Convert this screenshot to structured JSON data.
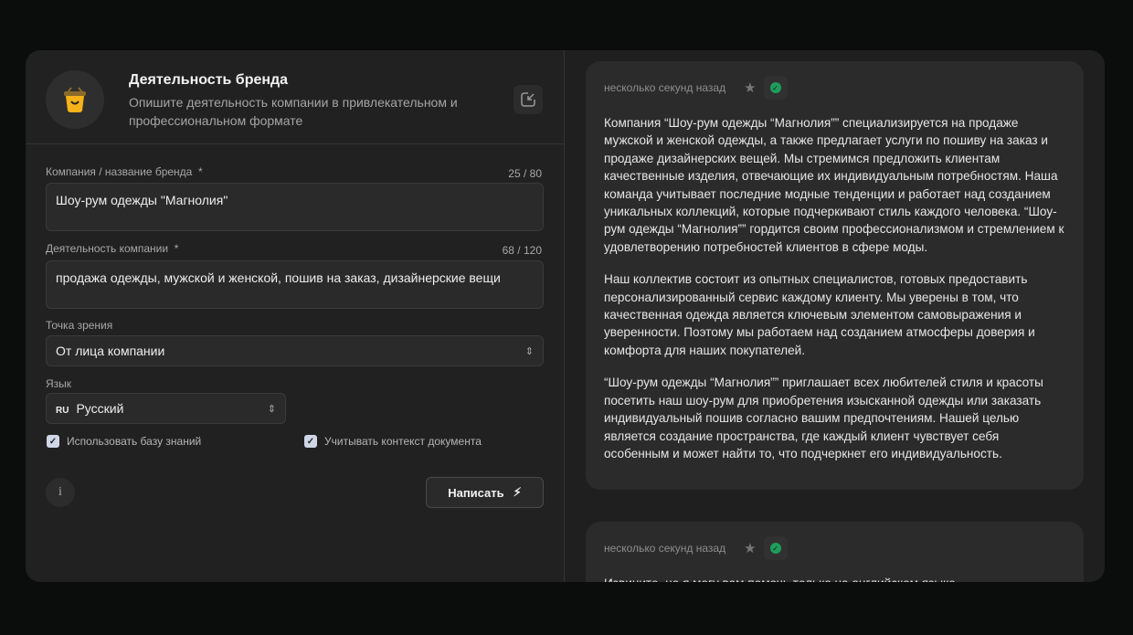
{
  "header": {
    "title": "Деятельность бренда",
    "subtitle": "Опишите деятельность компании в привлекательном и профессиональном формате"
  },
  "form": {
    "company": {
      "label": "Компания / название бренда",
      "required": "*",
      "counter": "25 / 80",
      "value": "Шоу-рум одежды \"Магнолия\""
    },
    "activity": {
      "label": "Деятельность компании",
      "required": "*",
      "counter": "68 / 120",
      "value": "продажа одежды, мужской и женской, пошив на заказ, дизайнерские вещи"
    },
    "pov": {
      "label": "Точка зрения",
      "value": "От лица компании"
    },
    "language": {
      "label": "Язык",
      "code": "RU",
      "value": "Русский"
    },
    "use_kb": {
      "label": "Использовать базу знаний",
      "checked": true
    },
    "use_context": {
      "label": "Учитывать контекст документа",
      "checked": true
    },
    "write_button": "Написать"
  },
  "results": [
    {
      "time": "несколько секунд назад",
      "paragraphs": [
        "Компания “Шоу-рум одежды “Магнолия”” специализируется на продаже мужской и женской одежды, а также предлагает услуги по пошиву на заказ и продаже дизайнерских вещей. Мы стремимся предложить клиентам качественные изделия, отвечающие их индивидуальным потребностям. Наша команда учитывает последние модные тенденции и работает над созданием уникальных коллекций, которые подчеркивают стиль каждого человека. “Шоу-рум одежды “Магнолия”” гордится своим профессионализмом и стремлением к удовлетворению потребностей клиентов в сфере моды.",
        "Наш коллектив состоит из опытных специалистов, готовых предоставить персонализированный сервис каждому клиенту. Мы уверены в том, что качественная одежда является ключевым элементом самовыражения и уверенности. Поэтому мы работаем над созданием атмосферы доверия и комфорта для наших покупателей.",
        "“Шоу-рум одежды “Магнолия”” приглашает всех любителей стиля и красоты посетить наш шоу-рум для приобретения изысканной одежды или заказать индивидуальный пошив согласно вашим предпочтениям. Нашей целью является создание пространства, где каждый клиент чувствует себя особенным и может найти то, что подчеркнет его индивидуальность."
      ]
    },
    {
      "time": "несколько секунд назад",
      "paragraphs": [
        "Извините, но я могу вам помочь только на английском языке."
      ]
    }
  ]
}
